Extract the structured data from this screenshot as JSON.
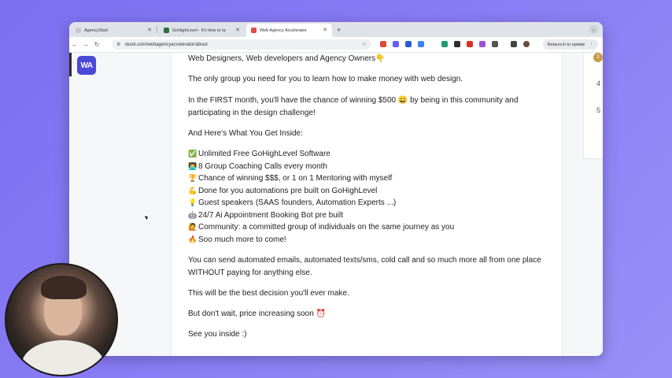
{
  "browser": {
    "tabs": [
      {
        "title": "AgencyStart",
        "active": false,
        "icon_color": "#c7c9cc"
      },
      {
        "title": "GoHighLevel - It's time to ta",
        "active": false,
        "icon_color": "#2e6b3d"
      },
      {
        "title": "Web Agency Accelerator",
        "active": true,
        "icon_color": "#e24b4b"
      }
    ],
    "url": "skool.com/webagencyaccelerator/about",
    "relaunch_label": "Relaunch to update",
    "extension_colors": [
      "#e0473f",
      "#6a5cf0",
      "#2a5ad8",
      "#3b82f6",
      "#1e9e70",
      "#2e2e2e",
      "#d93025",
      "#a14fd6",
      "#555555"
    ]
  },
  "sidebar": {
    "logo_text": "WA"
  },
  "right_panel": {
    "badge": "3",
    "numbers": [
      "4",
      "5"
    ]
  },
  "post": {
    "intro": "Web Designers, Web developers and Agency Owners👇",
    "p1": "The only group you need for you to learn how to make money with web design.",
    "p2": "In the FIRST month, you'll have the chance of winning $500 😀 by being in this community and participating in the design challenge!",
    "p3": "And Here's What You Get Inside:",
    "list": [
      {
        "emoji": "✅",
        "text": "Unlimited Free GoHighLevel Software"
      },
      {
        "emoji": "👨‍💻",
        "text": "8 Group Coaching Calls every month"
      },
      {
        "emoji": "🏆",
        "text": "Chance of winning $$$, or 1 on 1 Mentoring with myself"
      },
      {
        "emoji": "💪",
        "text": "Done for you automations pre built on GoHighLevel"
      },
      {
        "emoji": "💡",
        "text": "Guest speakers (SAAS founders, Automation Experts ...)"
      },
      {
        "emoji": "🤖",
        "text": "24/7 Ai Appointment Booking Bot pre built"
      },
      {
        "emoji": "🙋",
        "text": "Community: a committed group of individuals on the same journey as you"
      },
      {
        "emoji": "🔥",
        "text": "Soo much more to come!"
      }
    ],
    "p4": "You can send automated emails, automated texts/sms, cold call and so much more all from one place WITHOUT paying for anything else.",
    "p5": "This will be the best decision you'll ever make.",
    "p6": "But don't wait, price increasing soon ⏰",
    "p7": "See you inside :)"
  }
}
